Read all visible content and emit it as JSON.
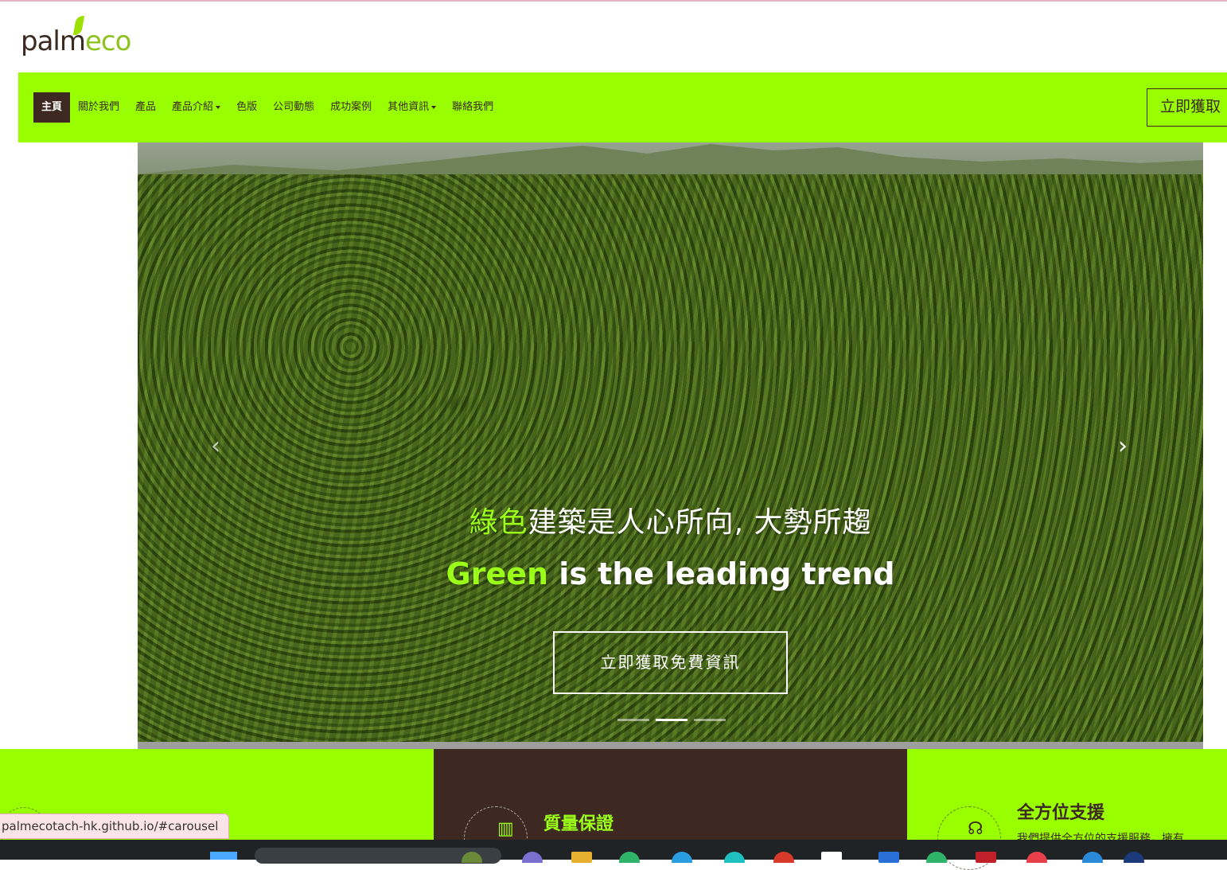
{
  "logo": {
    "prefix": "palm",
    "suffix": "eco"
  },
  "navbar": {
    "items": [
      {
        "label": "主頁",
        "active": true,
        "dropdown": false
      },
      {
        "label": "關於我們",
        "active": false,
        "dropdown": false
      },
      {
        "label": "產品",
        "active": false,
        "dropdown": false
      },
      {
        "label": "產品介紹",
        "active": false,
        "dropdown": true
      },
      {
        "label": "色版",
        "active": false,
        "dropdown": false
      },
      {
        "label": "公司動態",
        "active": false,
        "dropdown": false
      },
      {
        "label": "成功案例",
        "active": false,
        "dropdown": false
      },
      {
        "label": "其他資訊",
        "active": false,
        "dropdown": true
      },
      {
        "label": "聯絡我們",
        "active": false,
        "dropdown": false
      }
    ],
    "cta_label": "立即獲取"
  },
  "hero": {
    "headline_cn_highlight": "綠色",
    "headline_cn_rest": "建築是人心所向, 大勢所趨",
    "headline_en_highlight": "Green",
    "headline_en_rest": " is the leading trend",
    "cta_label": "立即獲取免費資訊",
    "slides_count": 3,
    "active_slide": 2
  },
  "features": {
    "mid": {
      "title": "質量保證"
    },
    "right": {
      "title": "全方位支援",
      "desc": "我們提供全方位的支援服務，擁有"
    }
  },
  "status_bar": {
    "url": "palmecotach-hk.github.io/#carousel"
  },
  "colors": {
    "accent": "#99ff00",
    "dark": "#3d2922",
    "headline_green": "#9bff1a"
  }
}
